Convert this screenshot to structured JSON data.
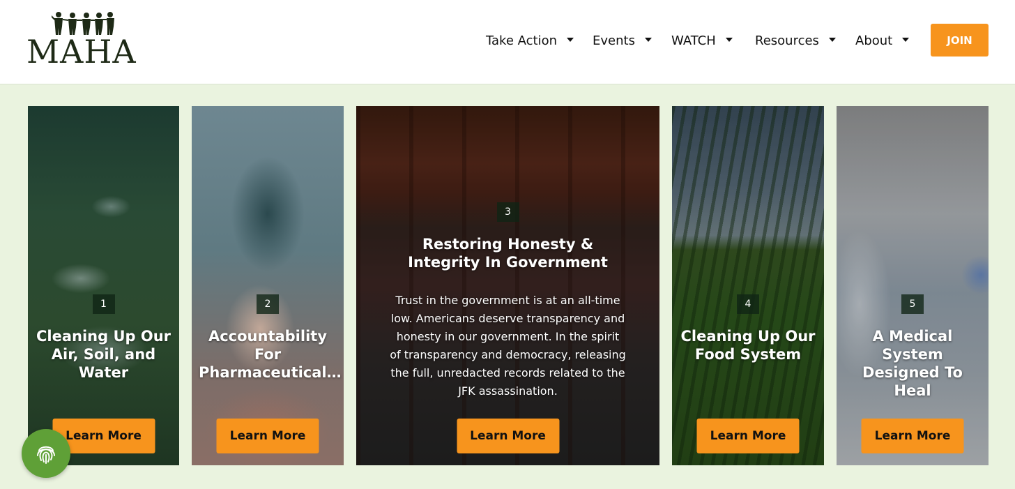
{
  "brand": {
    "logo_text": "MAHA"
  },
  "nav": {
    "items": [
      {
        "label": "Take Action"
      },
      {
        "label": "Events"
      },
      {
        "label": "WATCH"
      },
      {
        "label": "Resources"
      },
      {
        "label": "About"
      }
    ],
    "join_label": "JOIN"
  },
  "cards": [
    {
      "number": "1",
      "title": "Cleaning Up Our Air, Soil, and Water",
      "button": "Learn More"
    },
    {
      "number": "2",
      "title": "Accountability For Pharmaceutical…",
      "button": "Learn More"
    },
    {
      "number": "3",
      "title": "Restoring Honesty & Integrity In Government",
      "description": "Trust in the government is at an all-time low. Americans deserve transparency and honesty in our government. In the spirit of transparency and democracy, releasing the full, unredacted records related to the JFK assassination.",
      "button": "Learn More"
    },
    {
      "number": "4",
      "title": "Cleaning Up Our Food System",
      "button": "Learn More"
    },
    {
      "number": "5",
      "title": "A Medical System Designed To Heal",
      "button": "Learn More"
    }
  ],
  "colors": {
    "accent": "#f7941d",
    "page_background": "#eaf3df",
    "badge": "#102414",
    "fingerprint_widget": "#5fa037"
  },
  "icons": {
    "logo": "people-holding-hands-icon",
    "nav_caret": "caret-down-icon",
    "widget": "fingerprint-icon"
  }
}
